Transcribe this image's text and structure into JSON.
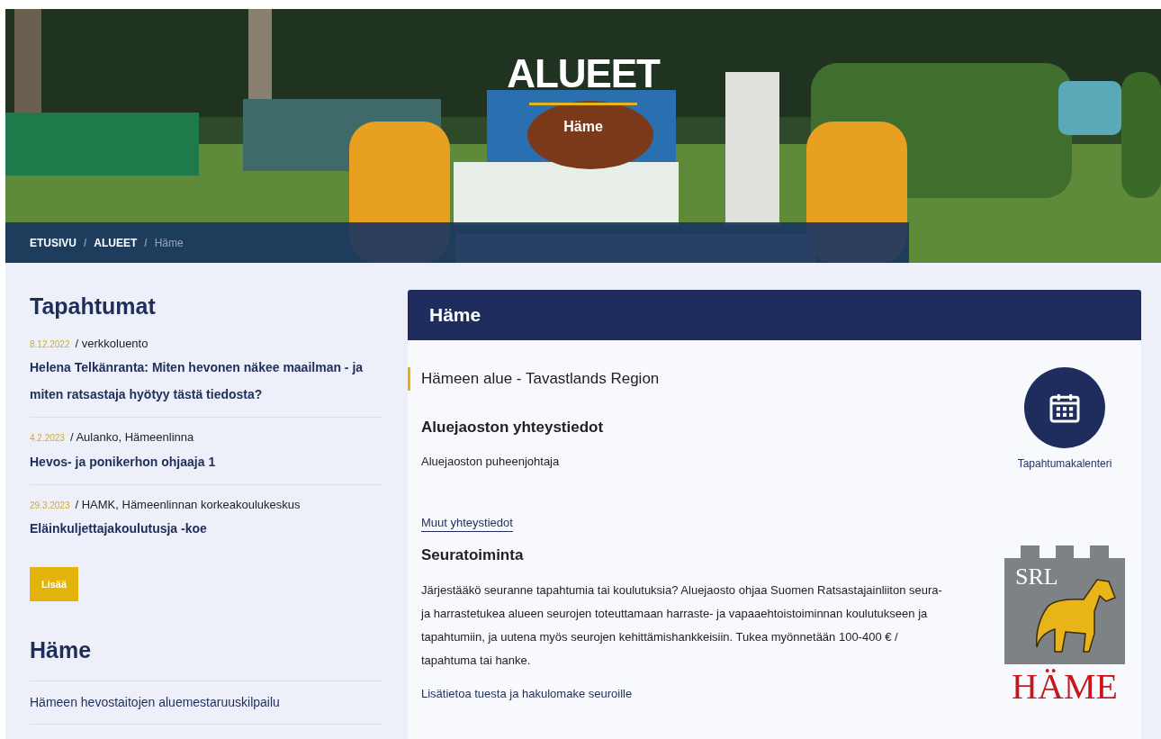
{
  "hero": {
    "title": "ALUEET",
    "subtitle": "Häme",
    "breadcrumb": [
      {
        "label": "ETUSIVU",
        "current": false
      },
      {
        "label": "ALUEET",
        "current": false
      },
      {
        "label": "Häme",
        "current": true
      }
    ],
    "separator": "/"
  },
  "events": {
    "heading": "Tapahtumat",
    "items": [
      {
        "date": "8.12.2022",
        "place": "/ verkkoluento",
        "title": "Helena Telkänranta: Miten hevonen näkee maailman - ja miten ratsastaja hyötyy tästä tiedosta?"
      },
      {
        "date": "4.2.2023",
        "place": "/ Aulanko, Hämeenlinna",
        "title": "Hevos- ja ponikerhon ohjaaja 1"
      },
      {
        "date": "29.3.2023",
        "place": "/ HAMK, Hämeenlinnan korkeakoulukeskus",
        "title": "Eläinkuljettajakoulutusja -koe"
      }
    ],
    "more_button": "Lisää"
  },
  "region_menu": {
    "heading": "Häme",
    "items": [
      "Hämeen hevostaitojen aluemestaruuskilpailu"
    ]
  },
  "card": {
    "title": "Häme",
    "lead": "Hämeen alue - Tavastlands Region",
    "contact_heading": "Aluejaoston yhteystiedot",
    "contact_label": "Aluejaoston puheenjohtaja",
    "contact_link": "Muut yhteystiedot",
    "club_heading": "Seuratoiminta",
    "club_text": "Järjestääkö seuranne tapahtumia tai koulutuksia? Aluejaosto ohjaa Suomen Ratsastajainliiton seura- ja harrastetukea alueen seurojen toteuttamaan harraste- ja vapaaehtoistoiminnan koulutukseen ja tapahtumiin, ja uutena myös seurojen kehittämishankkeisiin. Tukea myönnetään 100-400 € / tapahtuma tai hanke.",
    "club_link": "Lisätietoa tuesta ja hakulomake seuroille",
    "calendar_label": "Tapahtumakalenteri",
    "logo": {
      "top": "SRL",
      "bottom": "HÄME"
    }
  }
}
